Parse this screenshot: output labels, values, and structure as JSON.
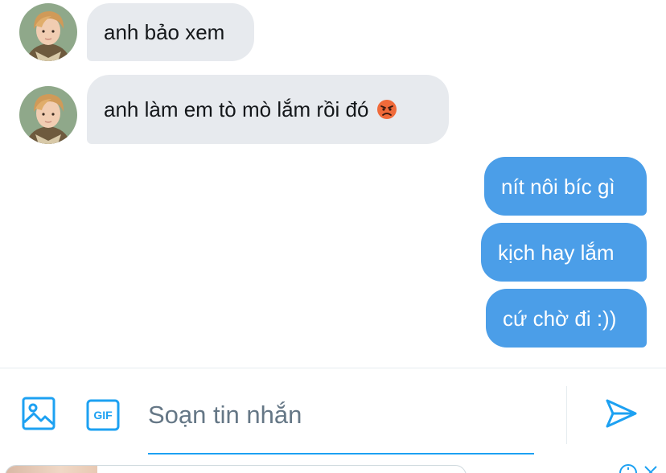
{
  "conversation": {
    "messages": [
      {
        "direction": "incoming",
        "text": "anh bảo xem",
        "emoji": ""
      },
      {
        "direction": "incoming",
        "text": "anh làm em tò mò lắm rồi đó",
        "emoji": "angry-face"
      },
      {
        "direction": "outgoing",
        "text": "nít nôi bíc gì"
      },
      {
        "direction": "outgoing",
        "text": "kịch hay lắm"
      },
      {
        "direction": "outgoing",
        "text": "cứ chờ đi :))"
      }
    ]
  },
  "composer": {
    "placeholder": "Soạn tin nhắn",
    "value": "",
    "gif_label": "GIF",
    "icons": [
      "image-icon",
      "gif-icon",
      "send-icon"
    ]
  },
  "colors": {
    "outgoing_bubble": "#4b9ee8",
    "incoming_bubble": "#e7eaee",
    "accent": "#1da1f2",
    "placeholder": "#657786"
  }
}
